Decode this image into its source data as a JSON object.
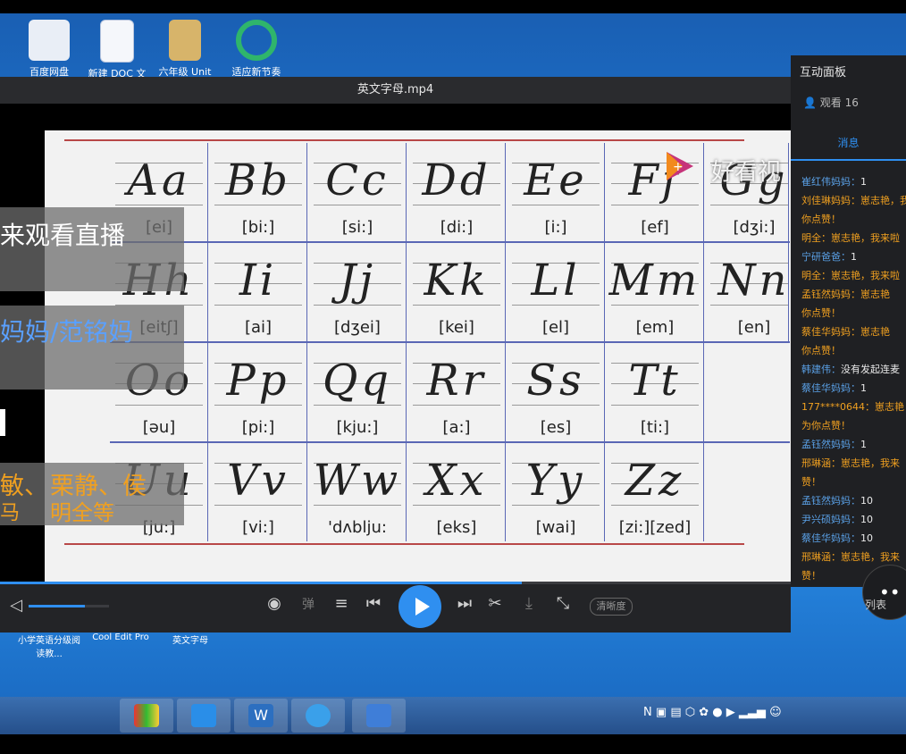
{
  "desktop": {
    "icons": [
      {
        "label": "百度网盘"
      },
      {
        "label": "新建 DOC 文"
      },
      {
        "label": "六年级 Unit"
      },
      {
        "label": "适应新节奏"
      }
    ],
    "bottom_icons": [
      {
        "label": "小学英语分级阅读教..."
      },
      {
        "label": "Cool Edit Pro"
      },
      {
        "label": "英文字母"
      }
    ]
  },
  "player": {
    "title": "英文字母.mp4",
    "watermark": "好看视",
    "quality_label": "清晰度",
    "danmu_label": "弹",
    "list_label": "列表",
    "progress": 0.66,
    "volume": 0.7
  },
  "alphabet": {
    "rows": [
      [
        {
          "letters": "Aa",
          "phonetic": "[ei]"
        },
        {
          "letters": "Bb",
          "phonetic": "[bi:]"
        },
        {
          "letters": "Cc",
          "phonetic": "[si:]"
        },
        {
          "letters": "Dd",
          "phonetic": "[di:]"
        },
        {
          "letters": "Ee",
          "phonetic": "[i:]"
        },
        {
          "letters": "Ff",
          "phonetic": "[ef]"
        },
        {
          "letters": "Gg",
          "phonetic": "[dʒi:]"
        }
      ],
      [
        {
          "letters": "Hh",
          "phonetic": "[eitʃ]"
        },
        {
          "letters": "Ii",
          "phonetic": "[ai]"
        },
        {
          "letters": "Jj",
          "phonetic": "[dʒei]"
        },
        {
          "letters": "Kk",
          "phonetic": "[kei]"
        },
        {
          "letters": "Ll",
          "phonetic": "[el]"
        },
        {
          "letters": "Mm",
          "phonetic": "[em]"
        },
        {
          "letters": "Nn",
          "phonetic": "[en]"
        }
      ],
      [
        {
          "letters": "Oo",
          "phonetic": "[əu]"
        },
        {
          "letters": "Pp",
          "phonetic": "[pi:]"
        },
        {
          "letters": "Qq",
          "phonetic": "[kju:]"
        },
        {
          "letters": "Rr",
          "phonetic": "[a:]"
        },
        {
          "letters": "Ss",
          "phonetic": "[es]"
        },
        {
          "letters": "Tt",
          "phonetic": "[ti:]"
        }
      ],
      [
        {
          "letters": "Uu",
          "phonetic": "[ju:]"
        },
        {
          "letters": "Vv",
          "phonetic": "[vi:]"
        },
        {
          "letters": "Ww",
          "phonetic": "'dʌblju:"
        },
        {
          "letters": "Xx",
          "phonetic": "[eks]"
        },
        {
          "letters": "Yy",
          "phonetic": "[wai]"
        },
        {
          "letters": "Zz",
          "phonetic": "[zi:][zed]"
        }
      ]
    ]
  },
  "overlay": {
    "line1": "来观看直播",
    "line2": "妈妈/范铭妈",
    "line3a": "敏、",
    "line3b": "栗静、侯",
    "line4a": "马",
    "line4b": "明全等"
  },
  "panel": {
    "title": "互动面板",
    "viewers": "观看 16",
    "tab": "消息",
    "messages": [
      {
        "name": "崔红伟妈妈：",
        "text": "1",
        "o": false
      },
      {
        "name": "刘佳琳妈妈：",
        "text": "崽志艳，我来啦",
        "o": true
      },
      {
        "name": "",
        "text": "你点赞！",
        "o": true
      },
      {
        "name": "",
        "text": "明全：崽志艳，我来啦",
        "o": true
      },
      {
        "name": "宁研爸爸：",
        "text": "1",
        "o": false
      },
      {
        "name": "",
        "text": "明全：崽志艳，我来啦",
        "o": true
      },
      {
        "name": "孟钰然妈妈：",
        "text": "崽志艳",
        "o": true
      },
      {
        "name": "",
        "text": "你点赞！",
        "o": true
      },
      {
        "name": "蔡佳华妈妈：",
        "text": "崽志艳",
        "o": true
      },
      {
        "name": "",
        "text": "你点赞！",
        "o": true
      },
      {
        "name": "韩建伟：",
        "text": "没有发起连麦",
        "o": false
      },
      {
        "name": "蔡佳华妈妈：",
        "text": "1",
        "o": false
      },
      {
        "name": "177****0644：",
        "text": "崽志艳",
        "o": true
      },
      {
        "name": "",
        "text": "为你点赞！",
        "o": true
      },
      {
        "name": "孟钰然妈妈：",
        "text": "1",
        "o": false
      },
      {
        "name": "邢琳涵：",
        "text": "崽志艳，我来",
        "o": true
      },
      {
        "name": "",
        "text": "赞！",
        "o": true
      },
      {
        "name": "孟钰然妈妈：",
        "text": "10",
        "o": false
      },
      {
        "name": "尹兴硕妈妈：",
        "text": "10",
        "o": false
      },
      {
        "name": "蔡佳华妈妈：",
        "text": "10",
        "o": false
      },
      {
        "name": "邢琳涵：",
        "text": "崽志艳，我来",
        "o": true
      },
      {
        "name": "",
        "text": "赞！",
        "o": true
      }
    ]
  },
  "colors": {
    "accent": "#2f8ff0",
    "message_orange": "#f0a020",
    "message_name_blue": "#5aa0e6",
    "grid_blue": "#5a67b5",
    "grid_red": "#b84848"
  }
}
